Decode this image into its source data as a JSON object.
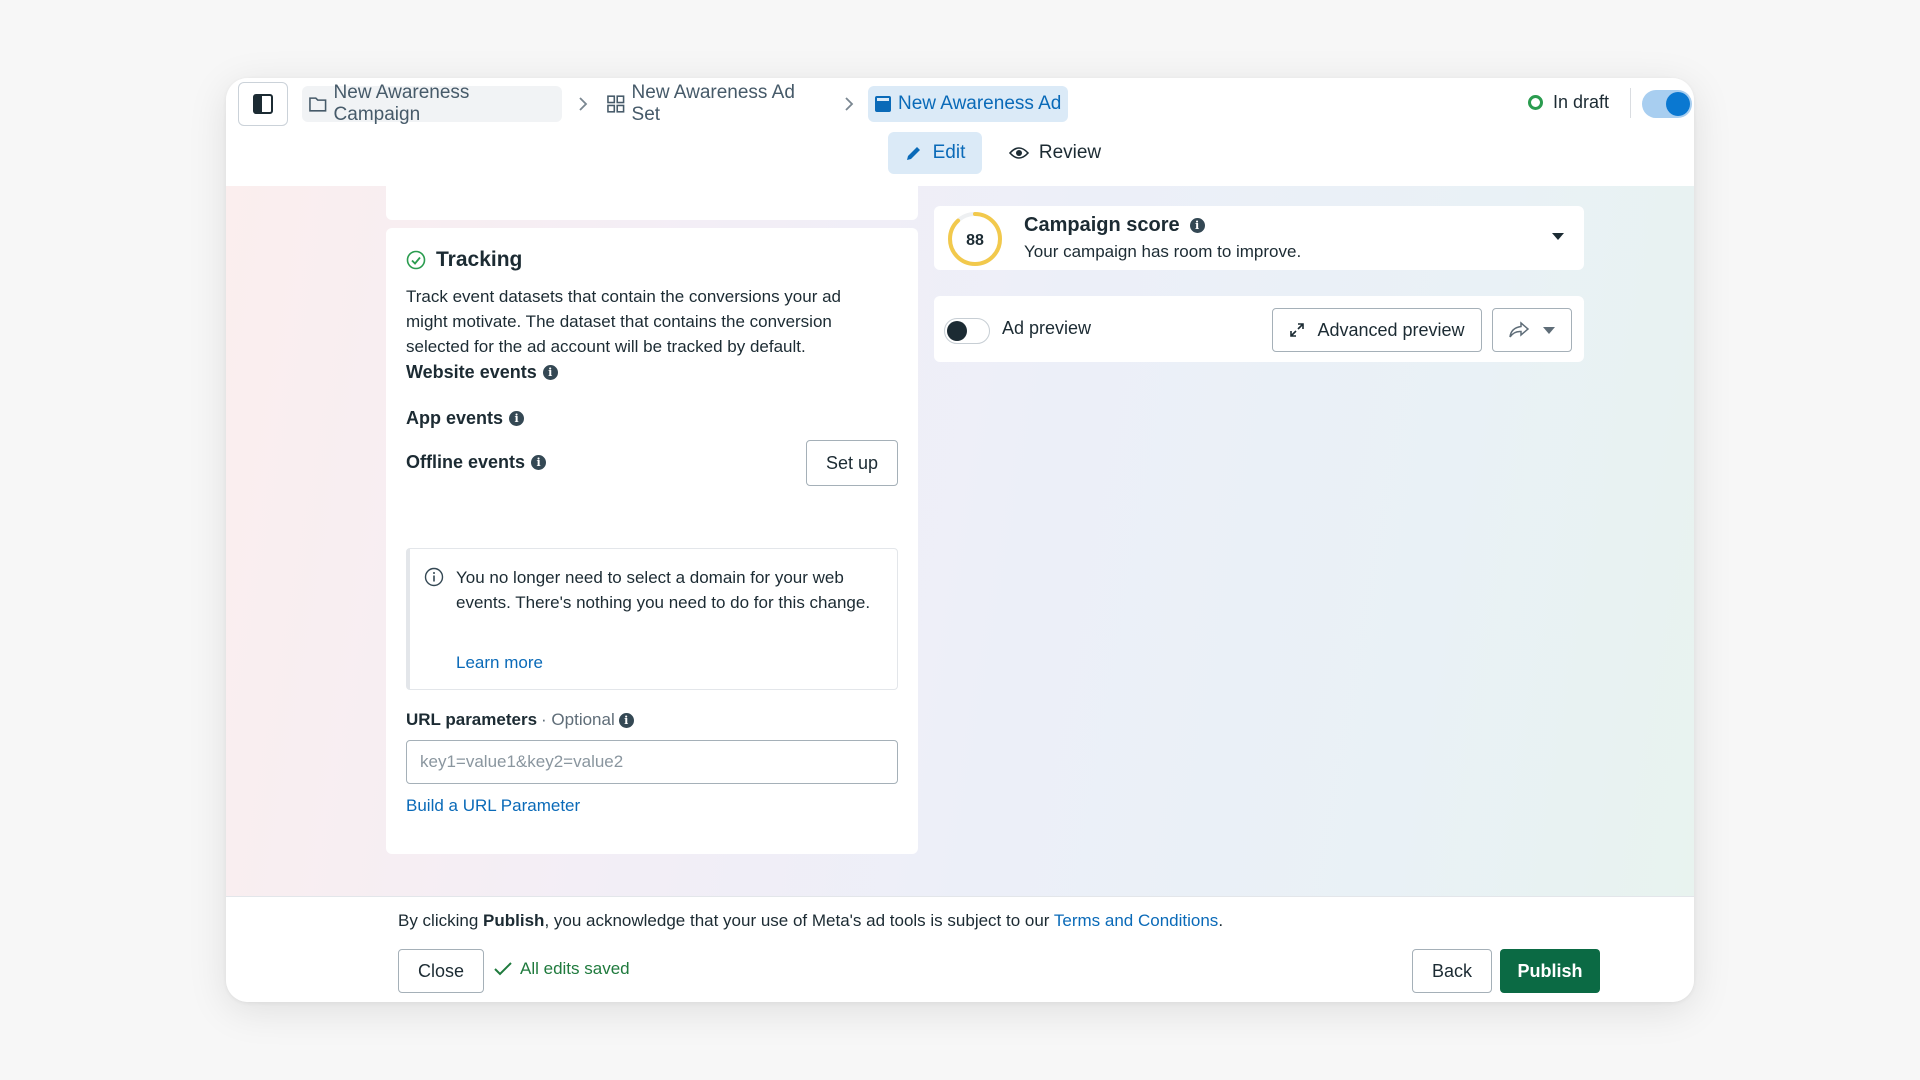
{
  "breadcrumb": {
    "campaign": "New Awareness Campaign",
    "ad_set": "New Awareness Ad Set",
    "ad": "New Awareness Ad"
  },
  "status": {
    "label": "In draft",
    "toggle_on": true
  },
  "modes": {
    "edit": "Edit",
    "review": "Review"
  },
  "tracking": {
    "title": "Tracking",
    "description": "Track event datasets that contain the conversions your ad might motivate. The dataset that contains the conversion selected for the ad account will be tracked by default.",
    "website_events": "Website events",
    "app_events": "App events",
    "setup_button": "Set up",
    "offline_events": "Offline events",
    "notice_text": "You no longer need to select a domain for your web events. There's nothing you need to do for this change.",
    "notice_link": "Learn more",
    "url_params_label": "URL parameters",
    "url_params_optional": "· Optional",
    "url_params_placeholder": "key1=value1&key2=value2",
    "build_link": "Build a URL Parameter"
  },
  "campaign_score": {
    "score": "88",
    "score_fraction": 0.88,
    "title": "Campaign score",
    "subtitle": "Your campaign has room to improve."
  },
  "ad_preview": {
    "label": "Ad preview",
    "toggle_on": false,
    "advanced_button": "Advanced preview"
  },
  "footer": {
    "legal_prefix": "By clicking ",
    "legal_bold": "Publish",
    "legal_middle": ", you acknowledge that your use of Meta's ad tools is subject to our ",
    "legal_link": "Terms and Conditions",
    "legal_suffix": ".",
    "close_button": "Close",
    "saved_status": "All edits saved",
    "back_button": "Back",
    "publish_button": "Publish"
  },
  "colors": {
    "accent": "#0a6ab8",
    "publish": "#0b6a44",
    "status_green": "#2a9c4f",
    "score_ring": "#f2c94c"
  }
}
